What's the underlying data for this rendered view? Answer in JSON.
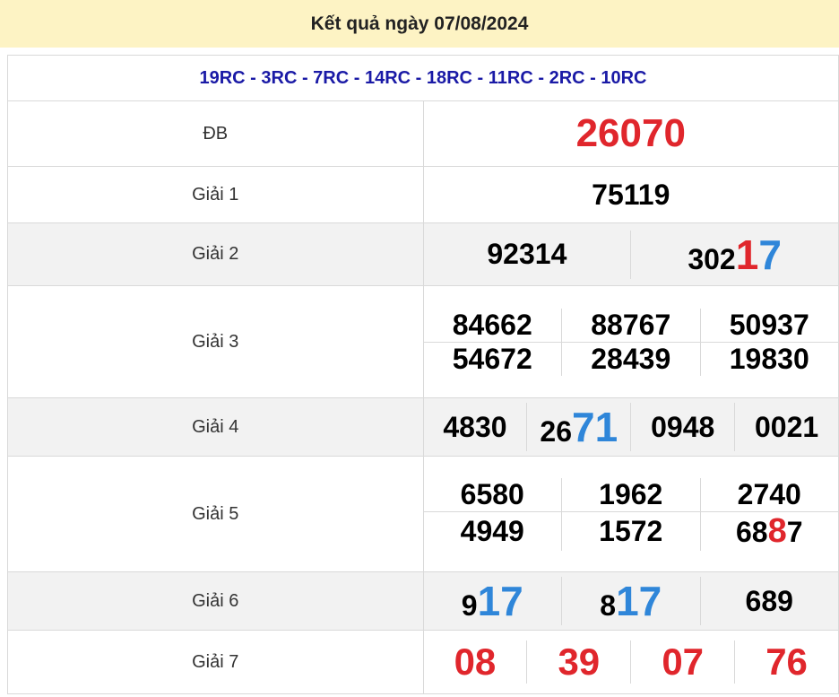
{
  "header": {
    "title": "Kết quả ngày 07/08/2024"
  },
  "codes": "19RC - 3RC - 7RC - 14RC - 18RC - 11RC - 2RC - 10RC",
  "colors": {
    "red": "#e0262c",
    "blue": "#2f86d9",
    "header_bg": "#fdf3c4",
    "codes": "#1a1aa6"
  },
  "prizes": {
    "db": {
      "label": "ĐB",
      "value": "26070"
    },
    "g1": {
      "label": "Giải 1",
      "value": "75119"
    },
    "g2": {
      "label": "Giải 2",
      "values": [
        "92314",
        "30217"
      ]
    },
    "g3": {
      "label": "Giải 3",
      "values": [
        "84662",
        "88767",
        "50937",
        "54672",
        "28439",
        "19830"
      ]
    },
    "g4": {
      "label": "Giải 4",
      "values": [
        "4830",
        "2671",
        "0948",
        "0021"
      ]
    },
    "g5": {
      "label": "Giải 5",
      "values": [
        "6580",
        "1962",
        "2740",
        "4949",
        "1572",
        "6887"
      ]
    },
    "g6": {
      "label": "Giải 6",
      "values": [
        "917",
        "817",
        "689"
      ]
    },
    "g7": {
      "label": "Giải 7",
      "values": [
        "08",
        "39",
        "07",
        "76"
      ]
    }
  },
  "highlights": {
    "g2_1": {
      "prefix": "302",
      "first": "1",
      "rest": "7"
    },
    "g4_1": {
      "prefix": "26",
      "digits": "71"
    },
    "g5_5": {
      "prefix": "68",
      "digit": "8",
      "suffix": "7"
    },
    "g6_0": {
      "prefix": "9",
      "digits": "17"
    },
    "g6_1": {
      "prefix": "8",
      "digits": "17"
    }
  }
}
